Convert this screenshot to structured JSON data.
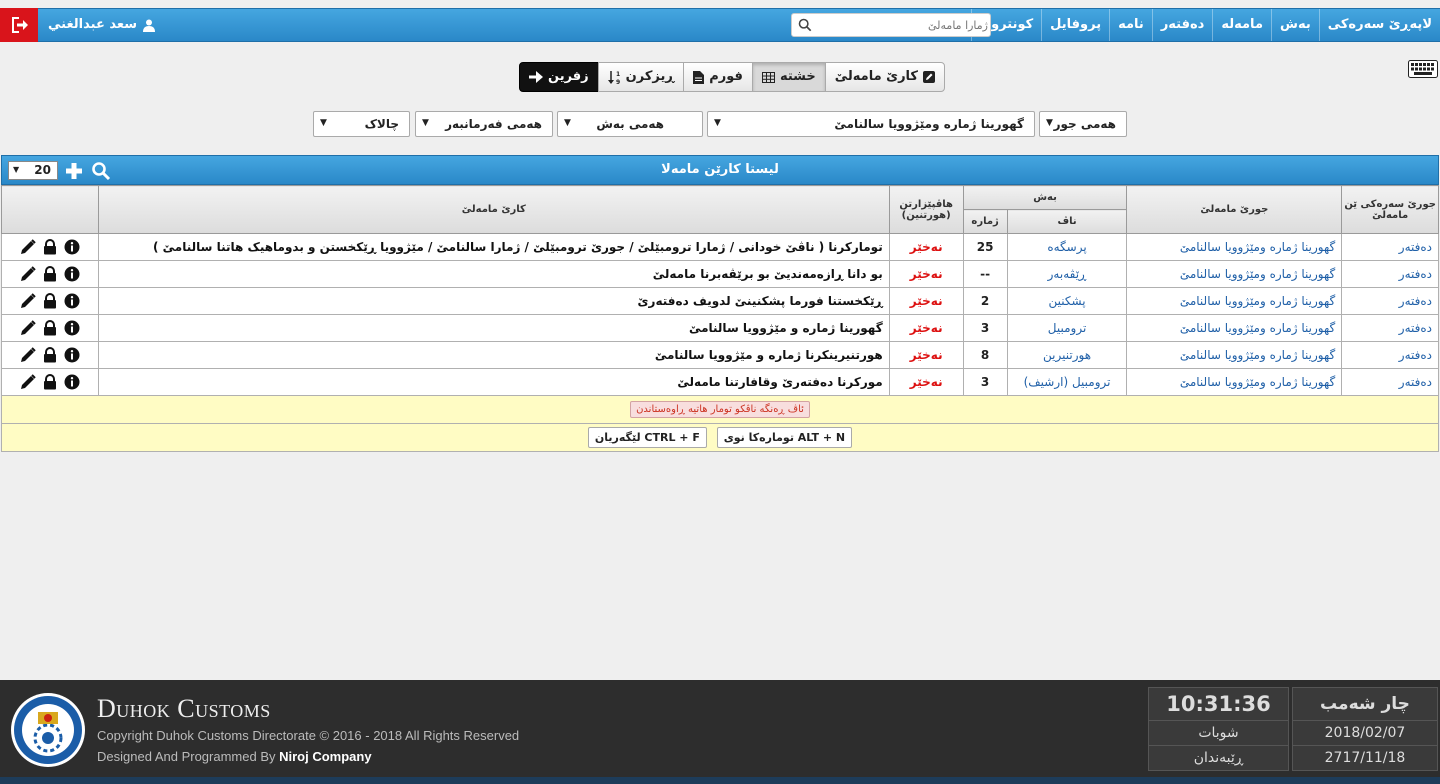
{
  "nav": {
    "items": [
      "لاپەڕێ سەرەکی",
      "بەش",
      "مامەلە",
      "دەفتەر",
      "نامە",
      "پروفایل",
      "کونترول"
    ],
    "search_placeholder": "ژمارا مامەلێ",
    "user_name": "سعد عبدالغني"
  },
  "toolbar": {
    "task_label": "کارێ مامەلێ",
    "grid_label": "خشتە",
    "form_label": "فورم",
    "sort_label": "ڕیزکرن",
    "back_label": "زفرین"
  },
  "filters": {
    "type": "هەمی جور",
    "category": "گهورینا ژمارە ومێژوویا سالنامێ",
    "section": "هەمی بەش",
    "employee": "هەمی فەرمانبەر",
    "status": "چالاک"
  },
  "panel": {
    "title": "لیستا کارێن مامەلا",
    "page_size": "20"
  },
  "table": {
    "headers": {
      "main_type": "جورێ سەرەکی ێن مامەلێ",
      "type": "جورێ مامەلێ",
      "section": "بەش",
      "section_name": "ناڤ",
      "section_number": "ژمارە",
      "attachments": "هاڤپێزارتن (هورتنین)",
      "task": "کارێ مامەلێ"
    },
    "rows": [
      {
        "main_type": "دەفتەر",
        "type": "گهورینا ژمارە ومێژوویا سالنامێ",
        "section_name": "پرسگەه",
        "section_number": "25",
        "attachments": "نەخێر",
        "task": "تومارکرنا ( ناڤێ خودانی / ژمارا ترومبێلێ / جورێ ترومبێلێ / ژمارا سالنامێ / مێژوویا ڕێکخستن و بدوماهیک هاتنا سالنامێ )"
      },
      {
        "main_type": "دەفتەر",
        "type": "گهورینا ژمارە ومێژوویا سالنامێ",
        "section_name": "ڕێڤەبەر",
        "section_number": "--",
        "attachments": "نەخێر",
        "task": "بو دانا ڕازەمەندیێ بو برێڤەبرنا مامەلێ"
      },
      {
        "main_type": "دەفتەر",
        "type": "گهورینا ژمارە ومێژوویا سالنامێ",
        "section_name": "پشکنین",
        "section_number": "2",
        "attachments": "نەخێر",
        "task": "ڕێکخستنا فورما پشکنینێ لدویف دەفتەرێ"
      },
      {
        "main_type": "دەفتەر",
        "type": "گهورینا ژمارە ومێژوویا سالنامێ",
        "section_name": "ترومبیل",
        "section_number": "3",
        "attachments": "نەخێر",
        "task": "گهورینا ژمارە و مێژوویا سالنامێ"
      },
      {
        "main_type": "دەفتەر",
        "type": "گهورینا ژمارە ومێژوویا سالنامێ",
        "section_name": "هورتنیرین",
        "section_number": "8",
        "attachments": "نەخێر",
        "task": "هورتنیرینکرنا ژمارە و مێژوویا سالنامێ"
      },
      {
        "main_type": "دەفتەر",
        "type": "گهورینا ژمارە ومێژوویا سالنامێ",
        "section_name": "ترومبیل (ارشیف)",
        "section_number": "3",
        "attachments": "نەخێر",
        "task": "مورکرنا دەفتەرێ وقافارتنا مامەلێ"
      }
    ],
    "note": "ئاڤ ڕەنگە ناڤکو تومار هاتیە ڕاوەستاندن",
    "shortcut_new": "ALT + N تومارەکا نوی",
    "shortcut_search": "CTRL + F لێگەریان"
  },
  "footer": {
    "brand": "Duhok Customs",
    "copyright": "Copyright Duhok Customs Directorate © 2016 - 2018 All Rights Reserved",
    "designed_prefix": "Designed And Programmed By ",
    "company": "Niroj Company",
    "day": "چار شەمب",
    "time": "10:31:36",
    "date_gregorian": "2018/02/07",
    "month_name": "شوبات",
    "date_kurdish": "2717/11/18",
    "calendar_label": "ڕێبەندان"
  },
  "colors": {
    "nav_blue": "#2a88c8",
    "logout_red": "#d9141b",
    "negative_red": "#dd1111",
    "link_blue": "#2060a8",
    "note_yellow": "#fffcc4"
  }
}
